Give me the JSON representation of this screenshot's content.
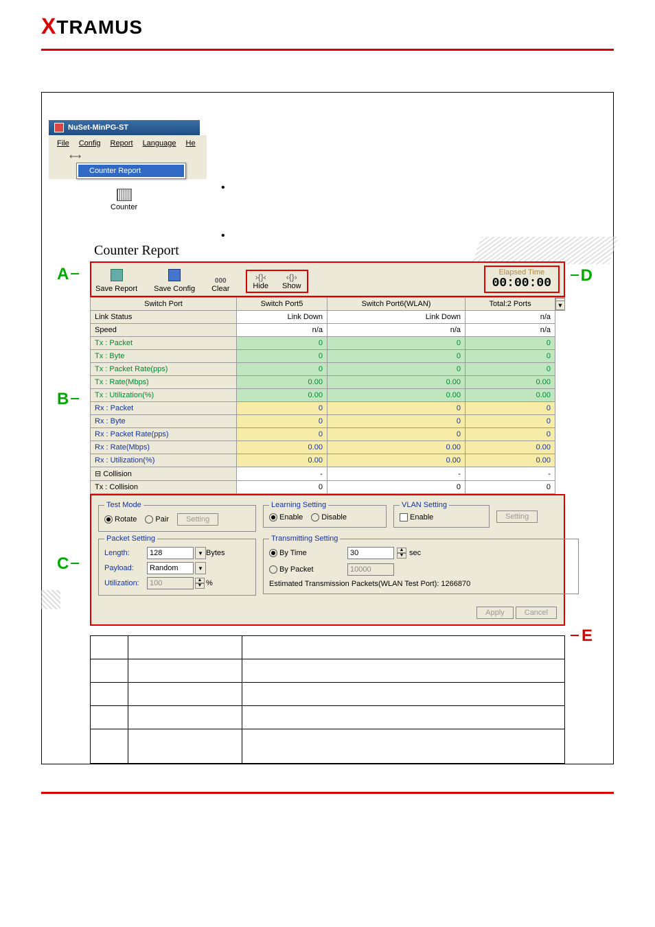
{
  "brand": {
    "prefix": "X",
    "rest": "TRAMUS"
  },
  "app": {
    "title": "NuSet-MinPG-ST",
    "menus": {
      "file": "File",
      "config": "Config",
      "report": "Report",
      "language": "Language",
      "help": "He"
    },
    "dropdown_item": "Counter Report",
    "counter_btn": "Counter"
  },
  "letters": {
    "A": "A",
    "B": "B",
    "C": "C",
    "D": "D",
    "E": "E"
  },
  "report": {
    "title": "Counter Report",
    "toolbar": {
      "save_report": "Save Report",
      "save_config": "Save Config",
      "clear": "Clear",
      "clear_icon": "000",
      "hide": "Hide",
      "hide_icon": "›{}‹",
      "show": "Show",
      "show_icon": "‹{}›"
    },
    "elapsed": {
      "label": "Elapsed Time",
      "value": "00:00:00"
    },
    "headers": [
      "Switch Port",
      "Switch Port5",
      "Switch Port6(WLAN)",
      "Total:2 Ports"
    ],
    "rows": [
      {
        "cls": "row-link",
        "cells": [
          "Link Status",
          "Link Down",
          "Link Down",
          "n/a"
        ]
      },
      {
        "cls": "row-speed",
        "cells": [
          "Speed",
          "n/a",
          "n/a",
          "n/a"
        ]
      },
      {
        "cls": "tx",
        "cells": [
          "Tx : Packet",
          "0",
          "0",
          "0"
        ]
      },
      {
        "cls": "tx",
        "cells": [
          "Tx : Byte",
          "0",
          "0",
          "0"
        ]
      },
      {
        "cls": "tx",
        "cells": [
          "Tx : Packet Rate(pps)",
          "0",
          "0",
          "0"
        ]
      },
      {
        "cls": "tx",
        "cells": [
          "Tx : Rate(Mbps)",
          "0.00",
          "0.00",
          "0.00"
        ]
      },
      {
        "cls": "tx",
        "cells": [
          "Tx : Utilization(%)",
          "0.00",
          "0.00",
          "0.00"
        ]
      },
      {
        "cls": "rx",
        "cells": [
          "Rx : Packet",
          "0",
          "0",
          "0"
        ]
      },
      {
        "cls": "rx",
        "cells": [
          "Rx : Byte",
          "0",
          "0",
          "0"
        ]
      },
      {
        "cls": "rx",
        "cells": [
          "Rx : Packet Rate(pps)",
          "0",
          "0",
          "0"
        ]
      },
      {
        "cls": "rx",
        "cells": [
          "Rx : Rate(Mbps)",
          "0.00",
          "0.00",
          "0.00"
        ]
      },
      {
        "cls": "rx",
        "cells": [
          "Rx : Utilization(%)",
          "0.00",
          "0.00",
          "0.00"
        ]
      },
      {
        "cls": "coll",
        "cells": [
          "⊟ Collision",
          "-",
          "-",
          "-"
        ]
      },
      {
        "cls": "coll",
        "cells": [
          "   Tx : Collision",
          "0",
          "0",
          "0"
        ]
      }
    ]
  },
  "settings": {
    "test_mode": {
      "legend": "Test Mode",
      "rotate": "Rotate",
      "pair": "Pair",
      "setting": "Setting"
    },
    "learning": {
      "legend": "Learning Setting",
      "enable": "Enable",
      "disable": "Disable"
    },
    "vlan": {
      "legend": "VLAN Setting",
      "enable": "Enable",
      "setting": "Setting"
    },
    "packet": {
      "legend": "Packet Setting",
      "length_label": "Length:",
      "length_val": "128",
      "length_unit": "Bytes",
      "payload_label": "Payload:",
      "payload_val": "Random",
      "util_label": "Utilization:",
      "util_val": "100",
      "util_unit": "%"
    },
    "trans": {
      "legend": "Transmitting Setting",
      "by_time": "By Time",
      "time_val": "30",
      "time_unit": "sec",
      "by_packet": "By Packet",
      "packet_val": "10000",
      "est_label": "Estimated Transmission Packets(WLAN Test Port): 1266870"
    },
    "apply": "Apply",
    "cancel": "Cancel"
  }
}
